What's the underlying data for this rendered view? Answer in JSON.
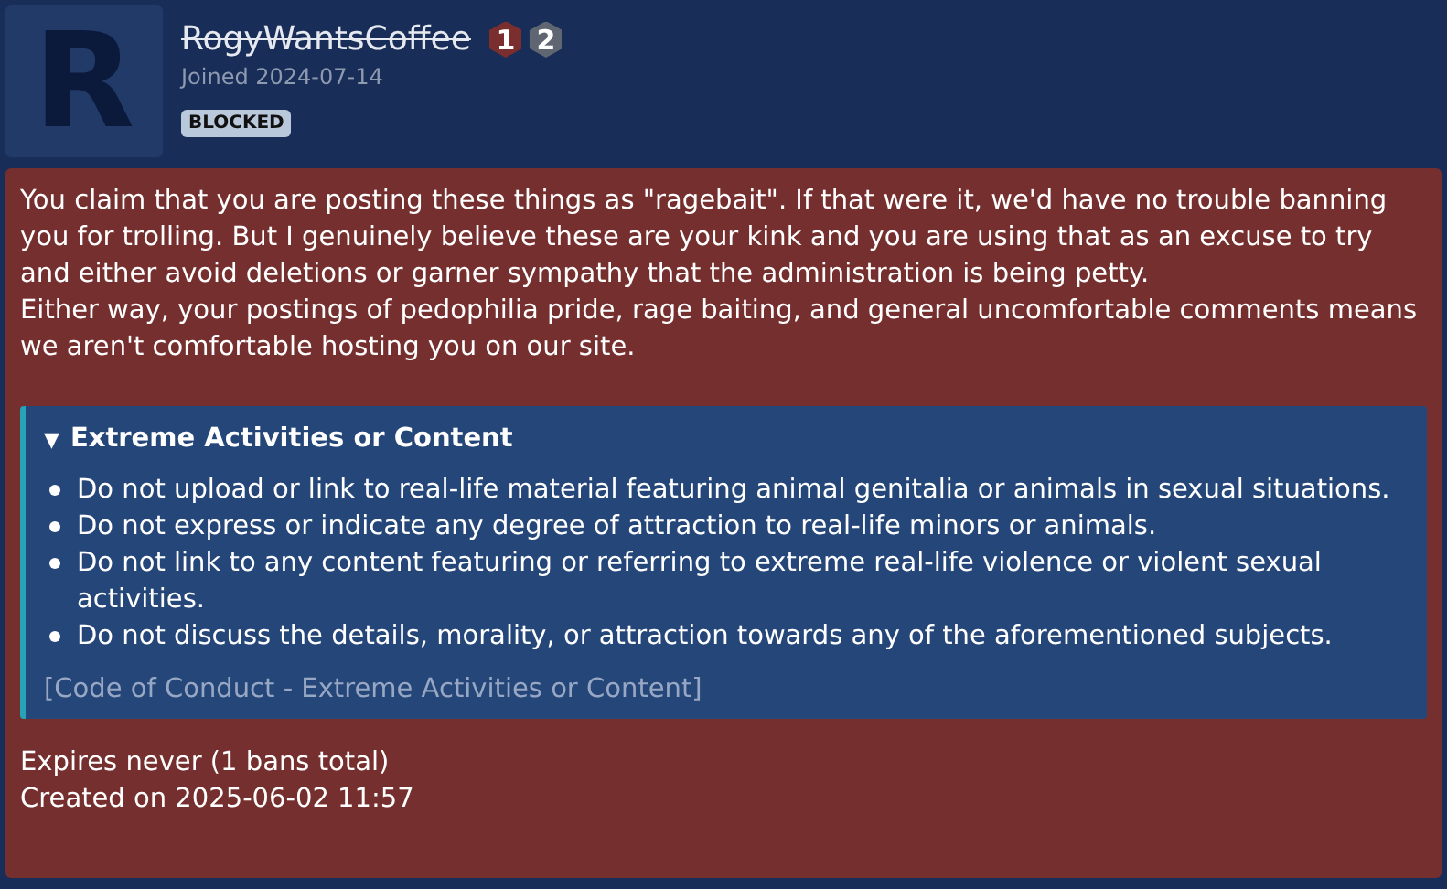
{
  "user": {
    "avatar_letter": "R",
    "name": "RogyWantsCoffee",
    "struck": true,
    "badges": [
      {
        "text": "1",
        "color": "#7a2e2e"
      },
      {
        "text": "2",
        "color": "#5f6671"
      }
    ],
    "joined": "Joined 2024-07-14",
    "status_tag": "BLOCKED"
  },
  "ban": {
    "message": [
      "You claim that you are posting these things as \"ragebait\". If that were it, we'd have no trouble banning you for trolling. But I genuinely believe these are your kink and you are using that as an excuse to try and either avoid deletions or garner sympathy that the administration is being petty.",
      "Either way, your postings of pedophilia pride, rage baiting, and general uncomfortable comments means we aren't comfortable hosting you on our site."
    ],
    "rule": {
      "toggle": "▼",
      "title": "Extreme Activities or Content",
      "expanded": true,
      "items": [
        "Do not upload or link to real-life material featuring animal genitalia or animals in sexual situations.",
        "Do not express or indicate any degree of attraction to real-life minors or animals.",
        "Do not link to any content featuring or referring to extreme real-life violence or violent sexual activities.",
        "Do not discuss the details, morality, or attraction towards any of the aforementioned subjects."
      ],
      "link": "[Code of Conduct - Extreme Activities or Content]"
    },
    "expires": "Expires never (1 bans total)",
    "created": "Created on 2025-06-02 11:57"
  }
}
